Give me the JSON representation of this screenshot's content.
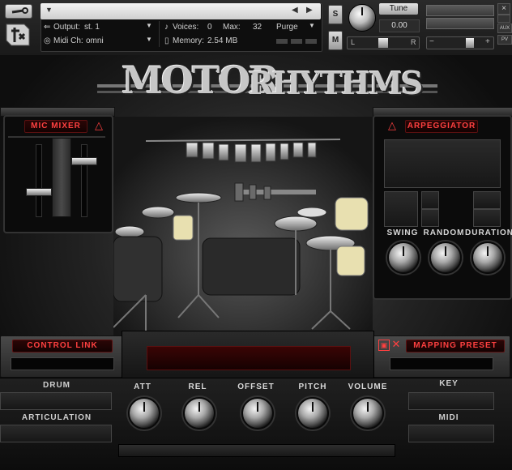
{
  "header": {
    "output_label": "Output:",
    "output_value": "st. 1",
    "voices_label": "Voices:",
    "voices_value": "0",
    "max_label": "Max:",
    "max_value": "32",
    "purge_label": "Purge",
    "midi_label": "Midi Ch:",
    "midi_value": "omni",
    "memory_label": "Memory:",
    "memory_value": "2.54 MB",
    "solo_label": "S",
    "mute_label": "M",
    "tune_label": "Tune",
    "tune_value": "0.00",
    "pan_left": "L",
    "pan_right": "R",
    "aux_label": "AUX",
    "pv_label": "PV"
  },
  "title": {
    "word1": "MOTOR",
    "word2": "RHYTHMS"
  },
  "mic_mixer": {
    "label": "MIC MIXER"
  },
  "arpeggiator": {
    "label": "ARPEGGIATOR",
    "knobs": [
      "SWING",
      "RANDOM",
      "DURATION"
    ]
  },
  "control_link": {
    "label": "CONTROL LINK"
  },
  "mapping_preset": {
    "label": "MAPPING PRESET"
  },
  "left_labels": {
    "drum": "DRUM",
    "articulation": "ARTICULATION"
  },
  "right_labels": {
    "key": "KEY",
    "midi": "MIDI"
  },
  "knobs": [
    "ATT",
    "REL",
    "OFFSET",
    "PITCH",
    "VOLUME"
  ],
  "colors": {
    "accent_red": "#ff4040",
    "panel_dark": "#0b0b0b"
  }
}
